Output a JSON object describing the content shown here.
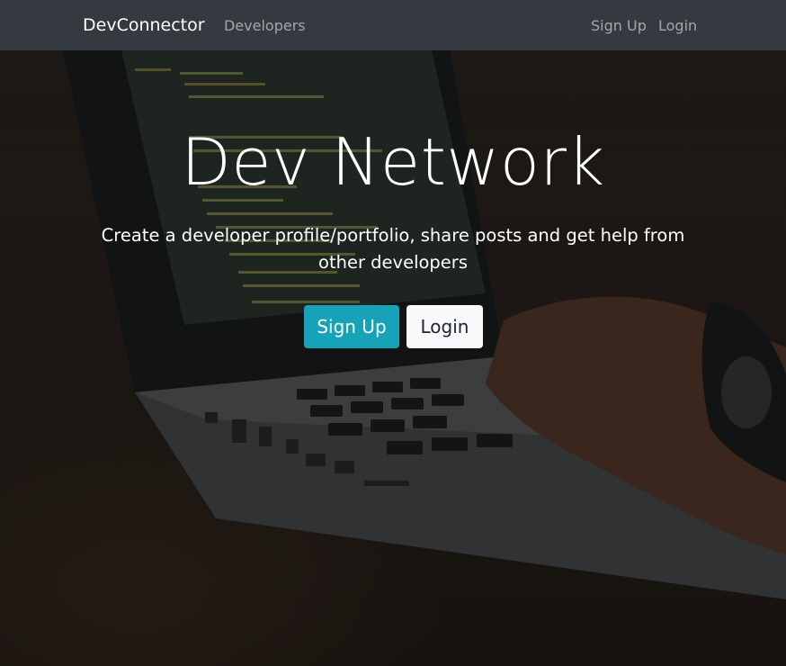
{
  "navbar": {
    "brand": "DevConnector",
    "links": {
      "developers": "Developers",
      "signup": "Sign Up",
      "login": "Login"
    }
  },
  "hero": {
    "title": "Dev Network",
    "lead": "Create a developer profile/portfolio, share posts and get help from other developers",
    "buttons": {
      "signup": "Sign Up",
      "login": "Login"
    }
  },
  "colors": {
    "navbar_bg": "#343a40",
    "signup_button": "#17a2b8",
    "login_button": "#f8f9fa"
  },
  "background_image": "laptop-coding-photo"
}
